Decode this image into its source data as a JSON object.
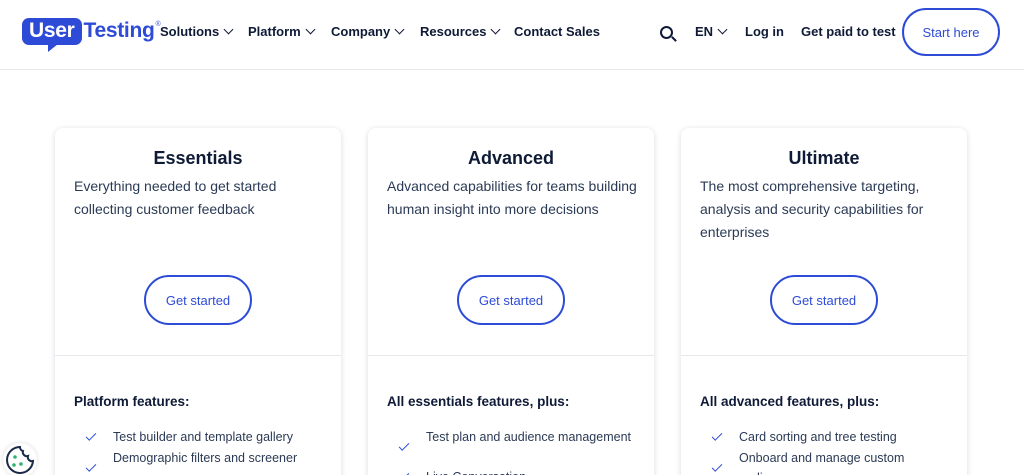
{
  "header": {
    "logo": {
      "box_text": "User",
      "text": "Testing",
      "tm": "®"
    },
    "nav": [
      {
        "label": "Solutions",
        "has_dropdown": true
      },
      {
        "label": "Platform",
        "has_dropdown": true
      },
      {
        "label": "Company",
        "has_dropdown": true
      },
      {
        "label": "Resources",
        "has_dropdown": true
      },
      {
        "label": "Contact Sales",
        "has_dropdown": false
      }
    ],
    "search_icon": "search-icon",
    "language": "EN",
    "login": "Log in",
    "get_paid": "Get paid to test",
    "start": "Start here"
  },
  "plans": [
    {
      "title": "Essentials",
      "description": "Everything needed to get started collecting customer feedback",
      "button": "Get started",
      "features_heading": "Platform features:",
      "features": [
        "Test builder and template gallery",
        "Demographic filters and screener"
      ]
    },
    {
      "title": "Advanced",
      "description": "Advanced capabilities for teams building human insight into more decisions",
      "button": "Get started",
      "features_heading": "All essentials features, plus:",
      "features": [
        "Test plan and audience management",
        "Live Conversation"
      ]
    },
    {
      "title": "Ultimate",
      "description": "The most comprehensive targeting, analysis and security capabilities for enterprises",
      "button": "Get started",
      "features_heading": "All advanced features, plus:",
      "features": [
        "Card sorting and tree testing",
        "Onboard and manage custom audiences"
      ]
    }
  ],
  "colors": {
    "brand": "#2d4bd7",
    "text_dark": "#0e1a36",
    "cookie": "#2bb673"
  },
  "cookie_icon": "cookie-icon"
}
